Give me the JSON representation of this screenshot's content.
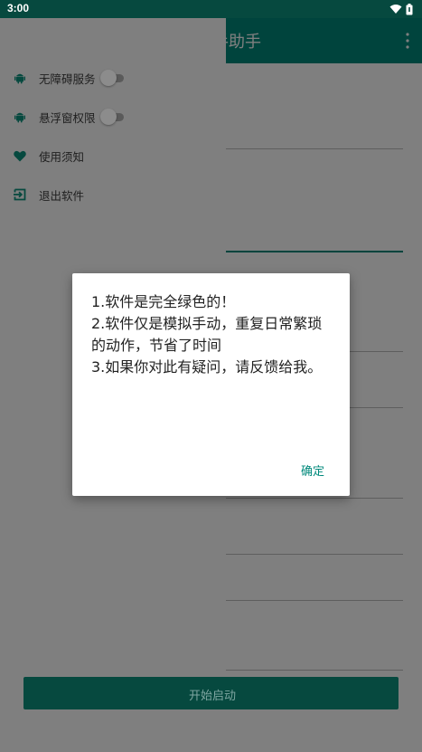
{
  "status_bar": {
    "time": "3:00",
    "icons": [
      "wifi-icon",
      "battery-icon"
    ]
  },
  "app": {
    "title_fragment": "手助手",
    "menu_icon": "overflow-menu-icon"
  },
  "drawer": {
    "items": [
      {
        "label": "无障碍服务",
        "icon": "android-icon",
        "has_switch": true,
        "switch_on": false
      },
      {
        "label": "悬浮窗权限",
        "icon": "android-icon",
        "has_switch": true,
        "switch_on": false
      },
      {
        "label": "使用须知",
        "icon": "heart-icon",
        "has_switch": false
      },
      {
        "label": "退出软件",
        "icon": "exit-icon",
        "has_switch": false
      }
    ]
  },
  "start_button": {
    "label": "开始启动"
  },
  "dialog": {
    "lines": [
      "1.软件是完全绿色的！",
      "2.软件仅是模拟手动，重复日常繁琐的动作，节省了时间",
      "3.如果你对此有疑问，请反馈给我。"
    ],
    "ok_label": "确定"
  },
  "colors": {
    "status_bar": "#06493f",
    "primary": "#00897b",
    "drawer_dimmed": "#7f7f7f",
    "button_dimmed": "#06493f"
  }
}
